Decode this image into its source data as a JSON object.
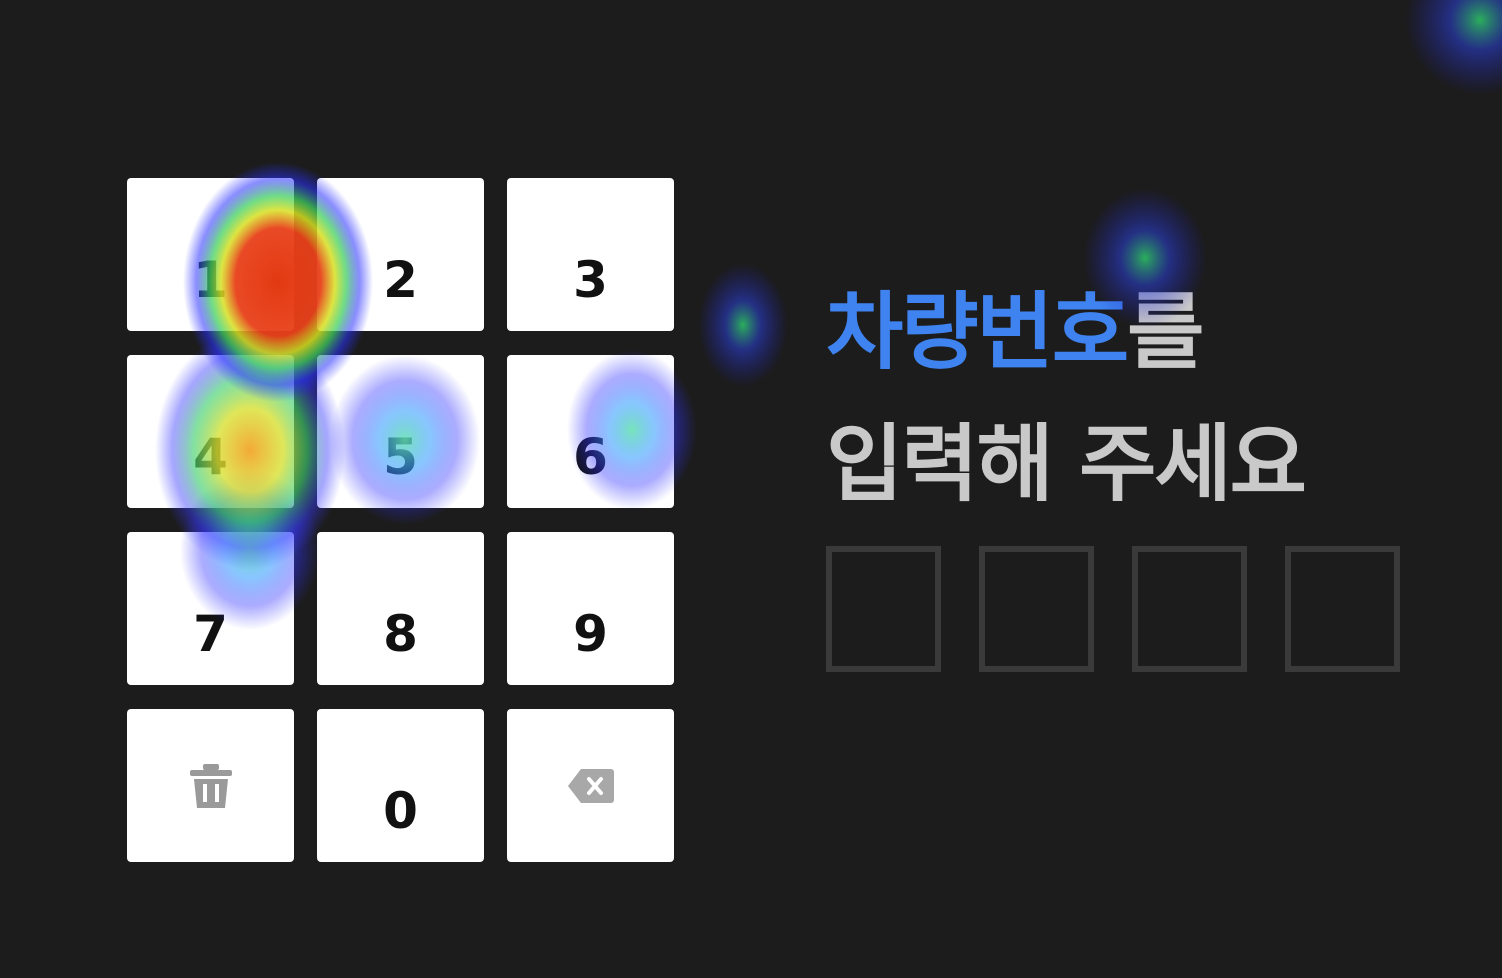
{
  "keypad": {
    "keys": [
      {
        "label": "1",
        "type": "digit"
      },
      {
        "label": "2",
        "type": "digit"
      },
      {
        "label": "3",
        "type": "digit"
      },
      {
        "label": "4",
        "type": "digit"
      },
      {
        "label": "5",
        "type": "digit"
      },
      {
        "label": "6",
        "type": "digit"
      },
      {
        "label": "7",
        "type": "digit"
      },
      {
        "label": "8",
        "type": "digit"
      },
      {
        "label": "9",
        "type": "digit"
      },
      {
        "label": "",
        "type": "clear",
        "icon": "trash-icon"
      },
      {
        "label": "0",
        "type": "digit"
      },
      {
        "label": "",
        "type": "backspace",
        "icon": "backspace-icon"
      }
    ]
  },
  "prompt": {
    "highlight": "차량번호",
    "rest": "를",
    "line2": "입력해 주세요"
  },
  "slots": [
    "",
    "",
    "",
    ""
  ],
  "colors": {
    "background": "#1c1c1c",
    "accent": "#3f83f0",
    "prompt_text": "#c9c9c9",
    "slot_border": "#3a3a3a",
    "key_bg": "#ffffff"
  }
}
